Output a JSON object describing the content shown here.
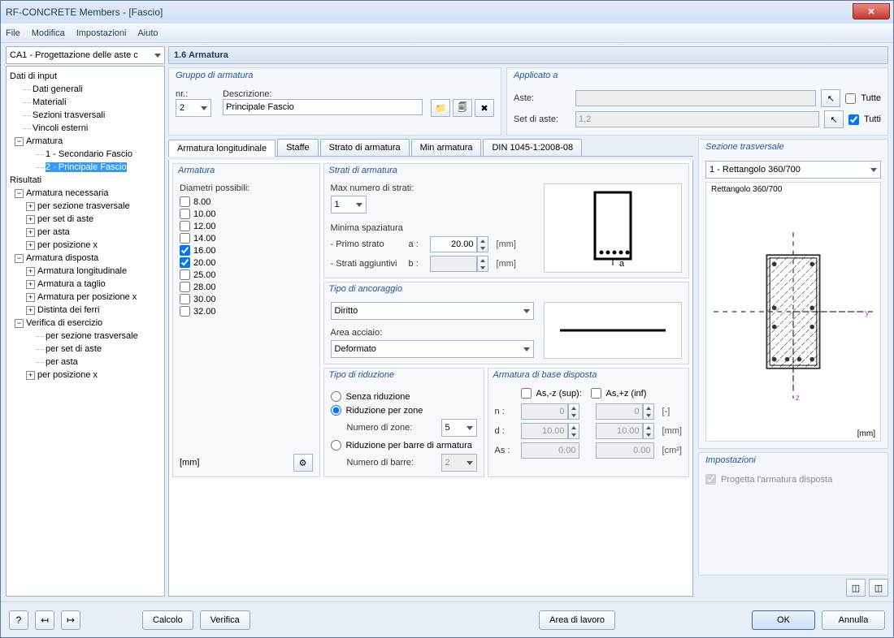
{
  "window": {
    "title": "RF-CONCRETE Members - [Fascio]"
  },
  "menu": [
    "File",
    "Modifica",
    "Impostazioni",
    "Aiuto"
  ],
  "caseSelector": "CA1 - Progettazione delle aste c",
  "tree": {
    "inputHdr": "Dati di input",
    "items1": [
      "Dati generali",
      "Materiali",
      "Sezioni trasversali",
      "Vincoli esterni"
    ],
    "armatura": "Armatura",
    "armaturaItems": [
      "1 - Secondario Fascio",
      "2 - Principale Fascio"
    ],
    "resultsHdr": "Risultati",
    "armReq": "Armatura necessaria",
    "armReqItems": [
      "per sezione trasversale",
      "per set di aste",
      "per asta",
      "per posizione x"
    ],
    "armDisp": "Armatura disposta",
    "armDispItems": [
      "Armatura longitudinale",
      "Armatura a taglio",
      "Armatura per posizione x",
      "Distinta dei ferri"
    ],
    "verEser": "Verifica di esercizio",
    "verEserItems": [
      "per sezione trasversale",
      "per set di aste",
      "per asta",
      "per posizione x"
    ]
  },
  "page": {
    "title": "1.6 Armatura"
  },
  "gruppo": {
    "hdr": "Gruppo di armatura",
    "nrLabel": "nr.:",
    "nrValue": "2",
    "descLabel": "Descrizione:",
    "descValue": "Principale Fascio"
  },
  "applicato": {
    "hdr": "Applicato a",
    "asteLabel": "Aste:",
    "asteValue": "",
    "setLabel": "Set di aste:",
    "setValue": "1,2",
    "tutteLabel": "Tutte",
    "tuttiLabel": "Tutti"
  },
  "tabs": [
    "Armatura longitudinale",
    "Staffe",
    "Strato di armatura",
    "Min armatura",
    "DIN 1045-1:2008-08"
  ],
  "armaturaPanel": {
    "hdr": "Armatura",
    "diamLabel": "Diametri possibili:",
    "diameters": [
      {
        "v": "8.00",
        "c": false
      },
      {
        "v": "10.00",
        "c": false
      },
      {
        "v": "12.00",
        "c": false
      },
      {
        "v": "14.00",
        "c": false
      },
      {
        "v": "16.00",
        "c": true
      },
      {
        "v": "20.00",
        "c": true
      },
      {
        "v": "25.00",
        "c": false
      },
      {
        "v": "28.00",
        "c": false
      },
      {
        "v": "30.00",
        "c": false
      },
      {
        "v": "32.00",
        "c": false
      }
    ],
    "unit": "[mm]"
  },
  "strati": {
    "hdr": "Strati di armatura",
    "maxLabel": "Max numero di strati:",
    "maxValue": "1",
    "minSpazLabel": "Minima spaziatura",
    "primoLabel": "- Primo strato",
    "aLabel": "a :",
    "aValue": "20.00",
    "stratiAggLabel": "- Strati aggiuntivi",
    "bLabel": "b :",
    "bValue": "",
    "unit": "[mm]"
  },
  "ancoraggio": {
    "hdr": "Tipo di ancoraggio",
    "value": "Diritto",
    "areaLabel": "Area acciaio:",
    "areaValue": "Deformato"
  },
  "riduzione": {
    "hdr": "Tipo di riduzione",
    "opt1": "Senza riduzione",
    "opt2": "Riduzione per zone",
    "numZoneLabel": "Numero di zone:",
    "numZoneValue": "5",
    "opt3": "Riduzione per barre di armatura",
    "numBarreLabel": "Numero di barre:",
    "numBarreValue": "2"
  },
  "base": {
    "hdr": "Armatura di base disposta",
    "as_sup": "As,-z (sup):",
    "as_inf": "As,+z (inf)",
    "nLabel": "n :",
    "nVal1": "0",
    "nVal2": "0",
    "nUnit": "[-]",
    "dLabel": "d :",
    "dVal1": "10.00",
    "dVal2": "10.00",
    "dUnit": "[mm]",
    "asLabel": "As :",
    "asVal1": "0.00",
    "asVal2": "0.00",
    "asUnit": "[cm²]"
  },
  "sezione": {
    "hdr": "Sezione trasversale",
    "value": "1 - Rettangolo 360/700",
    "caption": "Rettangolo 360/700",
    "unit": "[mm]",
    "y": "y",
    "z": "z"
  },
  "impostazioni": {
    "hdr": "Impostazioni",
    "chkLabel": "Progetta l'armatura disposta"
  },
  "footer": {
    "calcolo": "Calcolo",
    "verifica": "Verifica",
    "areaLavoro": "Area di lavoro",
    "ok": "OK",
    "annulla": "Annulla"
  }
}
